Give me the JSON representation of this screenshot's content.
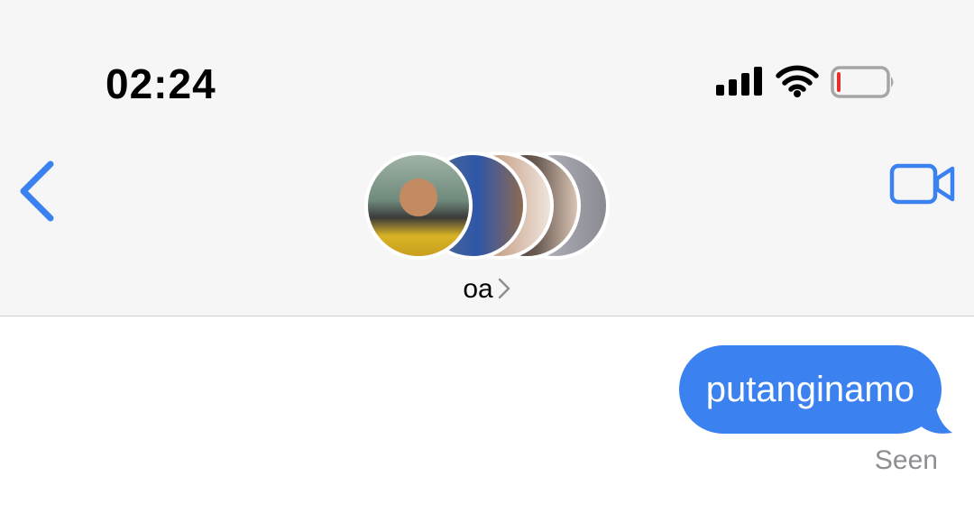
{
  "status_bar": {
    "time": "02:24",
    "icons": [
      "cellular-signal-icon",
      "wifi-icon",
      "battery-low-icon"
    ],
    "battery_level": 0.08
  },
  "header": {
    "contact_name": "oa",
    "back_icon": "chevron-left-icon",
    "video_icon": "video-camera-icon",
    "avatar_count": 5
  },
  "conversation": {
    "messages": [
      {
        "from": "me",
        "text": "putanginamo"
      }
    ],
    "read_receipt": "Seen"
  },
  "colors": {
    "accent": "#3b82f0",
    "bubble_text": "#ffffff",
    "battery_low": "#e5312a",
    "secondary_text": "#8e8e93"
  }
}
